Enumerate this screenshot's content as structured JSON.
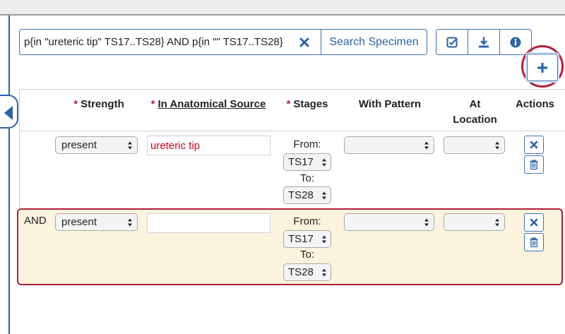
{
  "search": {
    "query": "p{in \"ureteric tip\" TS17..TS28} AND p{in \"\" TS17..TS28}",
    "search_label": "Search Specimen"
  },
  "icons": {
    "clear": "close-icon",
    "validate": "checkbox-check-icon",
    "download": "download-icon",
    "info": "info-icon",
    "add": "plus-icon",
    "panel_toggle": "chevron-left-icon",
    "row_clear": "close-icon",
    "row_delete": "trash-icon"
  },
  "colors": {
    "accent": "#2a63a8",
    "highlight": "#b01e3a",
    "required": "#b01e3a",
    "row_highlight_bg": "#fbf3dd",
    "source_text": "#d0021b"
  },
  "table": {
    "headers": {
      "strength": "Strength",
      "source": "In Anatomical Source",
      "stages": "Stages",
      "pattern": "With Pattern",
      "location_line1": "At",
      "location_line2": "Location",
      "actions": "Actions"
    },
    "required_mark": "*",
    "rows": [
      {
        "connector": "",
        "strength": "present",
        "source": "ureteric tip",
        "from_label": "From:",
        "from": "TS17",
        "to_label": "To:",
        "to": "TS28",
        "pattern": "",
        "location": ""
      },
      {
        "connector": "AND",
        "strength": "present",
        "source": "",
        "from_label": "From:",
        "from": "TS17",
        "to_label": "To:",
        "to": "TS28",
        "pattern": "",
        "location": ""
      }
    ]
  }
}
